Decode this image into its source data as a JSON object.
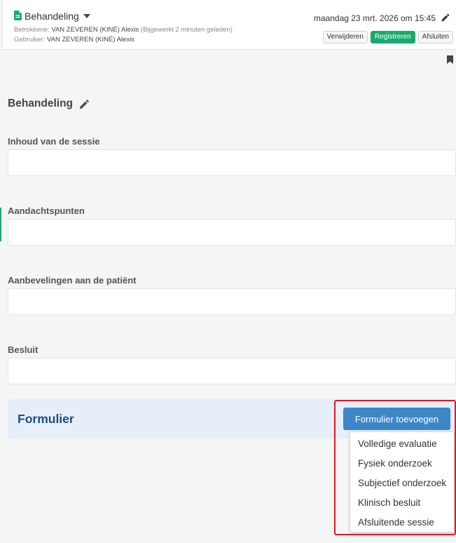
{
  "header": {
    "title": "Behandeling",
    "betrokkene_label": "Betrokkene:",
    "betrokkene_name": "VAN ZEVEREN (KINÉ) Alexis",
    "betrokkene_note": "(Bijgewerkt 2 minuten geleden)",
    "gebruiker_label": "Gebruiker:",
    "gebruiker_name": "VAN ZEVEREN (KINÉ) Alexis",
    "datetime": "maandag 23 mrt. 2026 om 15:45",
    "buttons": {
      "delete": "Verwijderen",
      "register": "Registreren",
      "close": "Afsluiten"
    }
  },
  "section": {
    "title": "Behandeling"
  },
  "fields": [
    {
      "label": "Inhoud van de sessie",
      "value": ""
    },
    {
      "label": "Aandachtspunten",
      "value": ""
    },
    {
      "label": "Aanbevelingen aan de patiënt",
      "value": ""
    },
    {
      "label": "Besluit",
      "value": ""
    }
  ],
  "form_panel": {
    "title": "Formulier",
    "add_button": "Formulier toevoegen",
    "menu_items": [
      "Volledige evaluatie",
      "Fysiek onderzoek",
      "Subjectief onderzoek",
      "Klinisch besluit",
      "Afsluitende sessie"
    ]
  },
  "colors": {
    "accent_green": "#1aaa6c",
    "primary_blue": "#3d86c8",
    "form_title": "#1c4e80",
    "highlight_red": "#e8141e"
  },
  "icons": {
    "document": "document-icon",
    "caret": "caret-down-icon",
    "edit": "pencil-icon",
    "bookmark": "bookmark-icon"
  }
}
